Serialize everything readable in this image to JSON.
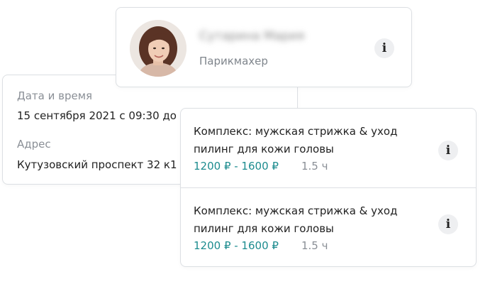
{
  "master": {
    "name": "Сутарина Мария",
    "role": "Парикмахер",
    "info_label": "i"
  },
  "booking": {
    "datetime_label": "Дата и время",
    "datetime_value": "15 сентября 2021 с 09:30 до",
    "address_label": "Адрес",
    "address_value": "Кутузовский проспект 32 к1"
  },
  "services": [
    {
      "title": "Комплекс: мужская стрижка & уход пилинг для кожи головы",
      "price": "1200 ₽ - 1600 ₽",
      "duration": "1.5 ч",
      "info_label": "i"
    },
    {
      "title": "Комплекс: мужская стрижка & уход пилинг для кожи головы",
      "price": "1200 ₽ - 1600 ₽",
      "duration": "1.5 ч",
      "info_label": "i"
    }
  ],
  "colors": {
    "price": "#1d8c8f",
    "muted": "#8a8f96",
    "border": "#dcdfe3"
  }
}
